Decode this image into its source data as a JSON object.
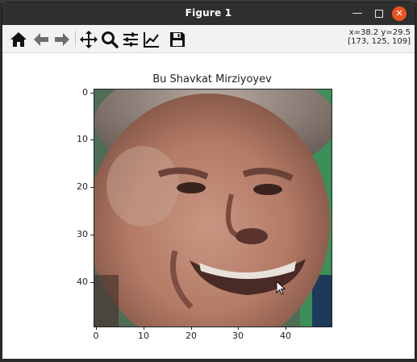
{
  "window": {
    "title": "Figure 1"
  },
  "toolbar": {
    "tools": [
      "home-icon",
      "back-arrow-icon",
      "forward-arrow-icon",
      "pan-icon",
      "zoom-icon",
      "configure-subplots-icon",
      "edit-axis-icon",
      "save-icon"
    ],
    "coords_line1": "x=38.2 y=29.5",
    "coords_line2": "[173, 125, 109]"
  },
  "figure": {
    "title": "Bu Shavkat Mirziyoyev",
    "y_ticks": [
      "0",
      "10",
      "20",
      "30",
      "40"
    ],
    "x_ticks": [
      "0",
      "10",
      "20",
      "30",
      "40"
    ],
    "image_extent": [
      0,
      50,
      50,
      0
    ]
  },
  "colors": {
    "titlebar": "#2f2f2f",
    "close_button": "#e95420",
    "toolbar_bg": "#f2f2f2"
  }
}
